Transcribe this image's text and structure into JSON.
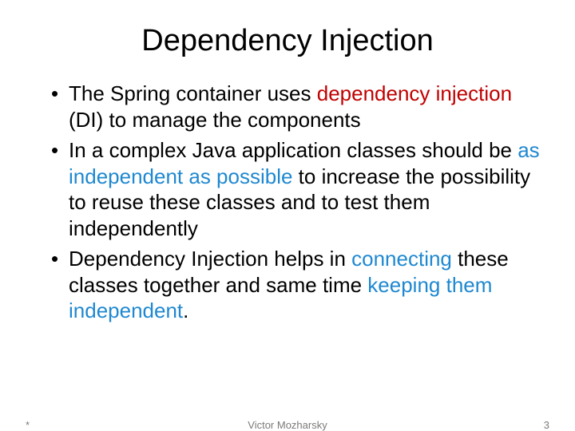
{
  "title": "Dependency Injection",
  "bullets": [
    {
      "pre": "The Spring container uses ",
      "hl": "dependency injection",
      "hlClass": "hl-red",
      "post": " (DI) to manage the components"
    },
    {
      "pre": "In a complex Java application classes should be ",
      "hl": "as independent as possible",
      "hlClass": "hl-blue",
      "post": " to increase the possibility to reuse these classes and  to  test  them  independently"
    },
    {
      "pre": "Dependency Injection helps in ",
      "hl": "connecting",
      "hlClass": "hl-blue",
      "mid": " these classes together and same time ",
      "hl2": "keeping them independent",
      "hl2Class": "hl-blue",
      "post": "."
    }
  ],
  "footer": {
    "left": "*",
    "center": "Victor Mozharsky",
    "right": "3"
  }
}
